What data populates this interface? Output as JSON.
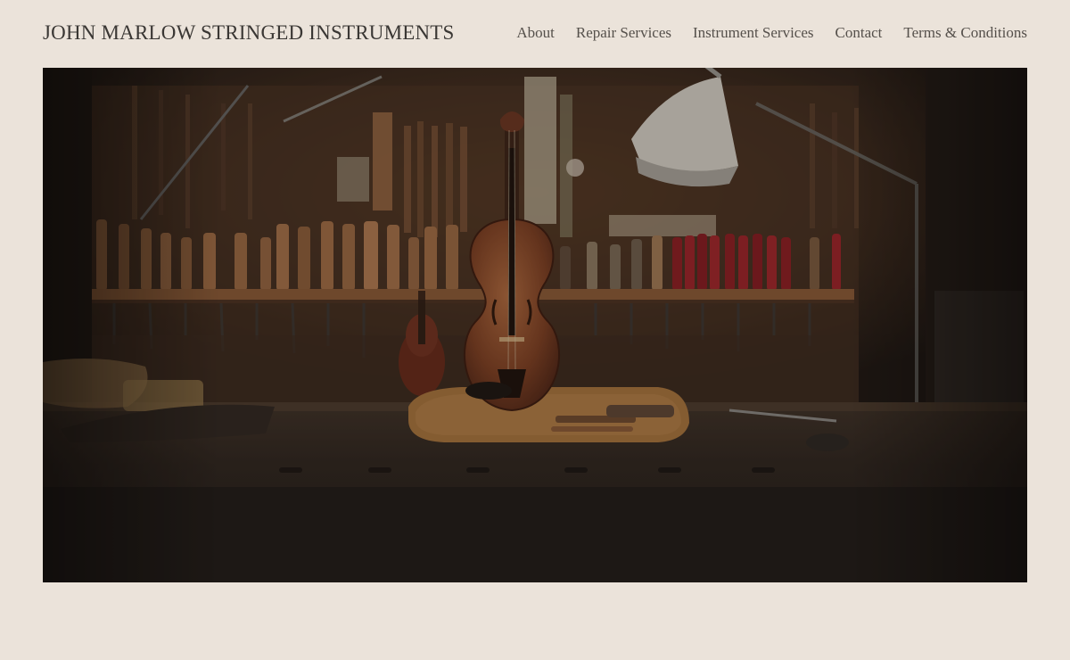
{
  "site": {
    "title": "JOHN MARLOW STRINGED INSTRUMENTS"
  },
  "nav": {
    "items": [
      {
        "label": "About"
      },
      {
        "label": "Repair Services"
      },
      {
        "label": "Instrument Services"
      },
      {
        "label": "Contact"
      },
      {
        "label": "Terms & Conditions"
      }
    ]
  },
  "hero": {
    "image": "workshop-violin-photo",
    "colors": {
      "page_background": "#ebe3da",
      "wall": "#3a2a1e",
      "bench": "#2a221c",
      "violin": "#8a4a2a",
      "red_handles": "#8c1c22"
    }
  }
}
